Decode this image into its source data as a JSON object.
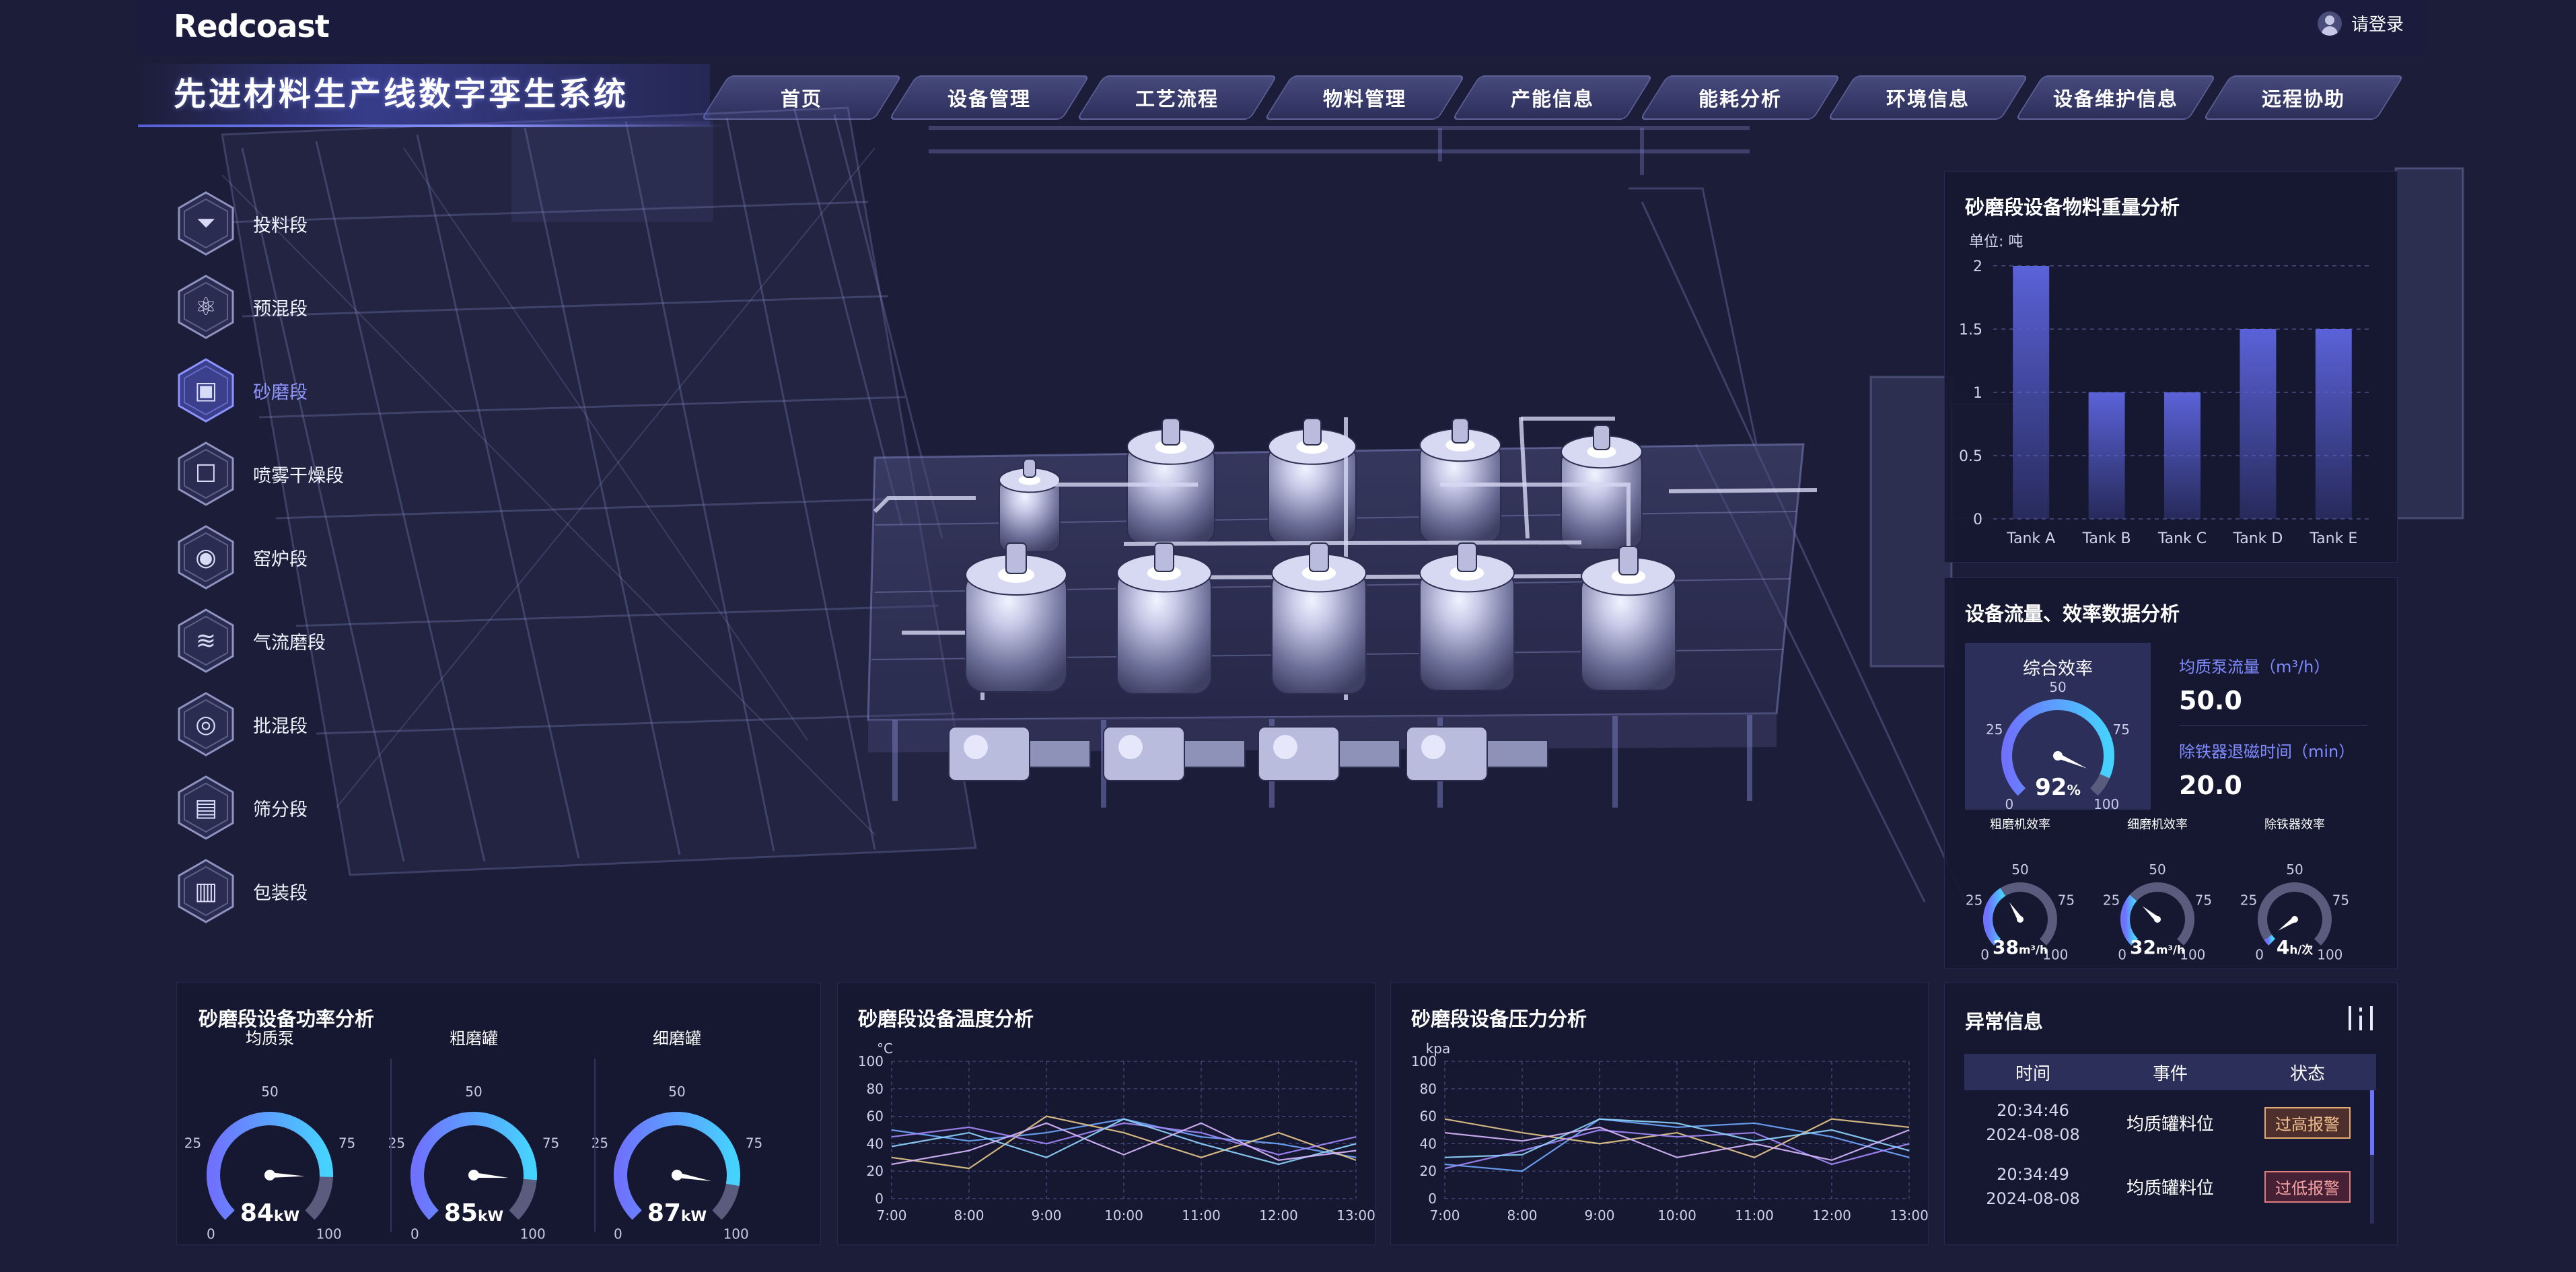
{
  "app": {
    "logo": "Redcoast",
    "title": "先进材料生产线数字孪生系统",
    "login_label": "请登录"
  },
  "nav": {
    "tabs": [
      "首页",
      "设备管理",
      "工艺流程",
      "物料管理",
      "产能信息",
      "能耗分析",
      "环境信息",
      "设备维护信息",
      "远程协助"
    ]
  },
  "stages": {
    "items": [
      {
        "label": "投料段",
        "icon": "funnel-icon"
      },
      {
        "label": "预混段",
        "icon": "molecule-icon"
      },
      {
        "label": "砂磨段",
        "icon": "mill-icon",
        "active": true
      },
      {
        "label": "喷雾干燥段",
        "icon": "dryer-icon"
      },
      {
        "label": "窑炉段",
        "icon": "kiln-icon"
      },
      {
        "label": "气流磨段",
        "icon": "airflow-icon"
      },
      {
        "label": "批混段",
        "icon": "batch-mix-icon"
      },
      {
        "label": "筛分段",
        "icon": "sieve-icon"
      },
      {
        "label": "包装段",
        "icon": "package-icon"
      }
    ]
  },
  "weight_panel": {
    "title": "砂磨段设备物料重量分析",
    "unit": "单位: 吨",
    "chart_data": {
      "type": "bar",
      "categories": [
        "Tank A",
        "Tank B",
        "Tank C",
        "Tank D",
        "Tank E"
      ],
      "values": [
        2,
        1,
        1,
        1.5,
        1.5
      ],
      "ylim": [
        0,
        2
      ],
      "yticks": [
        "0",
        "0.5",
        "1",
        "1.5",
        "2"
      ],
      "bar_color": "#5a62d8"
    }
  },
  "flow_panel": {
    "title": "设备流量、效率数据分析",
    "overall": {
      "label": "综合效率",
      "value": 92,
      "display": "92",
      "unit": "%",
      "ticks": [
        "0",
        "25",
        "50",
        "75",
        "100"
      ]
    },
    "kv": [
      {
        "title": "均质泵流量（m³/h）",
        "value": "50.0"
      },
      {
        "title": "除铁器退磁时间（min）",
        "value": "20.0"
      }
    ],
    "small_gauges": [
      {
        "label": "粗磨机效率",
        "value": 38,
        "display": "38",
        "unit": "m³/h",
        "ticks": [
          "0",
          "25",
          "50",
          "75",
          "100"
        ]
      },
      {
        "label": "细磨机效率",
        "value": 32,
        "display": "32",
        "unit": "m³/h",
        "ticks": [
          "0",
          "25",
          "50",
          "75",
          "100"
        ]
      },
      {
        "label": "除铁器效率",
        "value": 4,
        "display": "4",
        "unit": "h/次",
        "ticks": [
          "0",
          "25",
          "50",
          "75",
          "100"
        ]
      }
    ]
  },
  "power_panel": {
    "title": "砂磨段设备功率分析",
    "gauges": [
      {
        "label": "均质泵",
        "value": 84,
        "display": "84",
        "unit": "kW",
        "ticks": [
          "0",
          "25",
          "50",
          "75",
          "100"
        ]
      },
      {
        "label": "粗磨罐",
        "value": 85,
        "display": "85",
        "unit": "kW",
        "ticks": [
          "0",
          "25",
          "50",
          "75",
          "100"
        ]
      },
      {
        "label": "细磨罐",
        "value": 87,
        "display": "87",
        "unit": "kW",
        "ticks": [
          "0",
          "25",
          "50",
          "75",
          "100"
        ]
      }
    ]
  },
  "temp_panel": {
    "title": "砂磨段设备温度分析",
    "chart_data": {
      "type": "line",
      "ylabel": "°C",
      "x": [
        "7:00",
        "8:00",
        "9:00",
        "10:00",
        "11:00",
        "12:00",
        "13:00"
      ],
      "ylim": [
        0,
        100
      ],
      "yticks": [
        "0",
        "20",
        "40",
        "60",
        "80",
        "100"
      ],
      "series": [
        {
          "color": "#6fa8ff",
          "values": [
            50,
            42,
            48,
            58,
            45,
            40,
            30
          ]
        },
        {
          "color": "#e8c98b",
          "values": [
            30,
            22,
            60,
            48,
            30,
            48,
            28
          ]
        },
        {
          "color": "#a58bff",
          "values": [
            45,
            52,
            40,
            55,
            48,
            32,
            45
          ]
        },
        {
          "color": "#8fd6ff",
          "values": [
            38,
            48,
            30,
            58,
            40,
            25,
            40
          ]
        },
        {
          "color": "#d8b8ff",
          "values": [
            25,
            35,
            55,
            32,
            55,
            28,
            35
          ]
        }
      ]
    }
  },
  "pressure_panel": {
    "title": "砂磨段设备压力分析",
    "chart_data": {
      "type": "line",
      "ylabel": "kpa",
      "x": [
        "7:00",
        "8:00",
        "9:00",
        "10:00",
        "11:00",
        "12:00",
        "13:00"
      ],
      "ylim": [
        0,
        100
      ],
      "yticks": [
        "0",
        "20",
        "40",
        "60",
        "80",
        "100"
      ],
      "series": [
        {
          "color": "#6fa8ff",
          "values": [
            25,
            20,
            58,
            52,
            55,
            45,
            30
          ]
        },
        {
          "color": "#e8c98b",
          "values": [
            58,
            48,
            40,
            48,
            30,
            58,
            52
          ]
        },
        {
          "color": "#a58bff",
          "values": [
            22,
            35,
            50,
            45,
            48,
            25,
            40
          ]
        },
        {
          "color": "#8fd6ff",
          "values": [
            30,
            32,
            58,
            55,
            42,
            50,
            35
          ]
        },
        {
          "color": "#d8b8ff",
          "values": [
            48,
            42,
            52,
            30,
            40,
            28,
            50
          ]
        }
      ]
    }
  },
  "alarm_panel": {
    "title": "异常信息",
    "headers": [
      "时间",
      "事件",
      "状态"
    ],
    "rows": [
      {
        "time": "20:34:46",
        "date": "2024-08-08",
        "event": "均质罐料位",
        "status": "过高报警"
      },
      {
        "time": "20:34:49",
        "date": "2024-08-08",
        "event": "均质罐料位",
        "status": "过低报警"
      }
    ]
  }
}
